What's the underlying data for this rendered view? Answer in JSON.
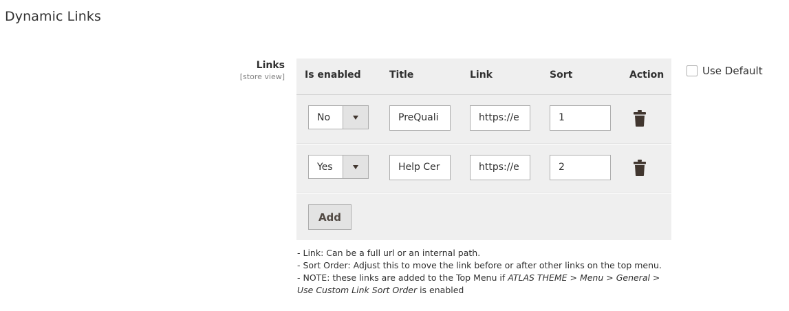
{
  "section": {
    "title": "Dynamic Links"
  },
  "field": {
    "label": "Links",
    "scope": "[store view]"
  },
  "grid": {
    "headers": {
      "enabled": "Is enabled",
      "title": "Title",
      "link": "Link",
      "sort": "Sort",
      "action": "Action"
    },
    "rows": [
      {
        "enabled": "No",
        "title": "PreQuali",
        "link": "https://e",
        "sort": "1"
      },
      {
        "enabled": "Yes",
        "title": "Help Cer",
        "link": "https://e",
        "sort": "2"
      }
    ],
    "add_label": "Add"
  },
  "use_default": {
    "label": "Use Default",
    "checked": false
  },
  "notes": {
    "line1": "- Link: Can be a full url or an internal path.",
    "line2": "- Sort Order: Adjust this to move the link before or after other links on the top menu.",
    "line3_prefix": "- NOTE: these links are added to the Top Menu if ",
    "line3_path": "ATLAS THEME > Menu > General >",
    "line4_path": "Use Custom Link Sort Order",
    "line4_suffix": " is enabled"
  },
  "icons": {
    "delete": "trash-icon",
    "dropdown": "chevron-down-icon"
  }
}
